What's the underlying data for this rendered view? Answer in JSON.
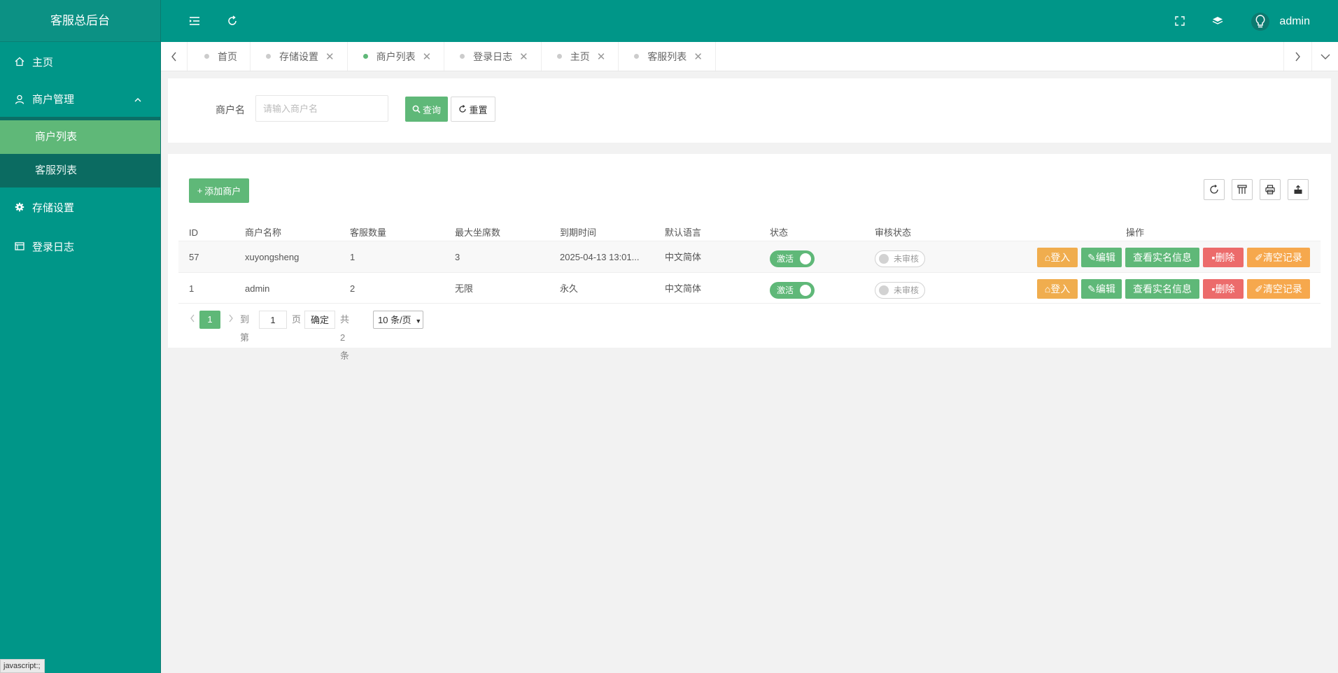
{
  "app": {
    "title": "客服总后台"
  },
  "sidebar": {
    "items": [
      {
        "label": "主页",
        "icon": "home-icon"
      },
      {
        "label": "商户管理",
        "icon": "user-icon",
        "expanded": true,
        "children": [
          {
            "label": "商户列表",
            "active": true
          },
          {
            "label": "客服列表"
          }
        ]
      },
      {
        "label": "存储设置",
        "icon": "gear-icon"
      },
      {
        "label": "登录日志",
        "icon": "log-icon"
      }
    ]
  },
  "header": {
    "user": "admin"
  },
  "tabs": [
    {
      "label": "首页",
      "closable": false
    },
    {
      "label": "存储设置",
      "closable": true
    },
    {
      "label": "商户列表",
      "closable": true,
      "active": true
    },
    {
      "label": "登录日志",
      "closable": true
    },
    {
      "label": "主页",
      "closable": true
    },
    {
      "label": "客服列表",
      "closable": true
    }
  ],
  "search": {
    "label": "商户名",
    "placeholder": "请输入商户名",
    "query_label": "查询",
    "reset_label": "重置"
  },
  "table": {
    "add_label": "添加商户",
    "columns": [
      "ID",
      "商户名称",
      "客服数量",
      "最大坐席数",
      "到期时间",
      "默认语言",
      "状态",
      "审核状态",
      "操作"
    ],
    "rows": [
      {
        "id": "57",
        "name": "xuyongsheng",
        "agents": "1",
        "max_seats": "3",
        "expire": "2025-04-13 13:01...",
        "lang": "中文简体",
        "status": "激活",
        "audit": "未审核"
      },
      {
        "id": "1",
        "name": "admin",
        "agents": "2",
        "max_seats": "无限",
        "expire": "永久",
        "lang": "中文简体",
        "status": "激活",
        "audit": "未审核"
      }
    ],
    "actions": {
      "login": "登入",
      "edit": "编辑",
      "view": "查看实名信息",
      "delete": "删除",
      "clear": "清空记录"
    }
  },
  "pager": {
    "current": "1",
    "goto_label": "到第",
    "goto_value": "1",
    "page_label": "页",
    "ok_label": "确定",
    "total": "共 2 条",
    "page_size": "10 条/页"
  },
  "status_bar": "javascript:;",
  "colors": {
    "primary": "#009688",
    "accent": "#5fb878",
    "danger": "#ec6b6b",
    "warn": "#f0ad4e"
  }
}
